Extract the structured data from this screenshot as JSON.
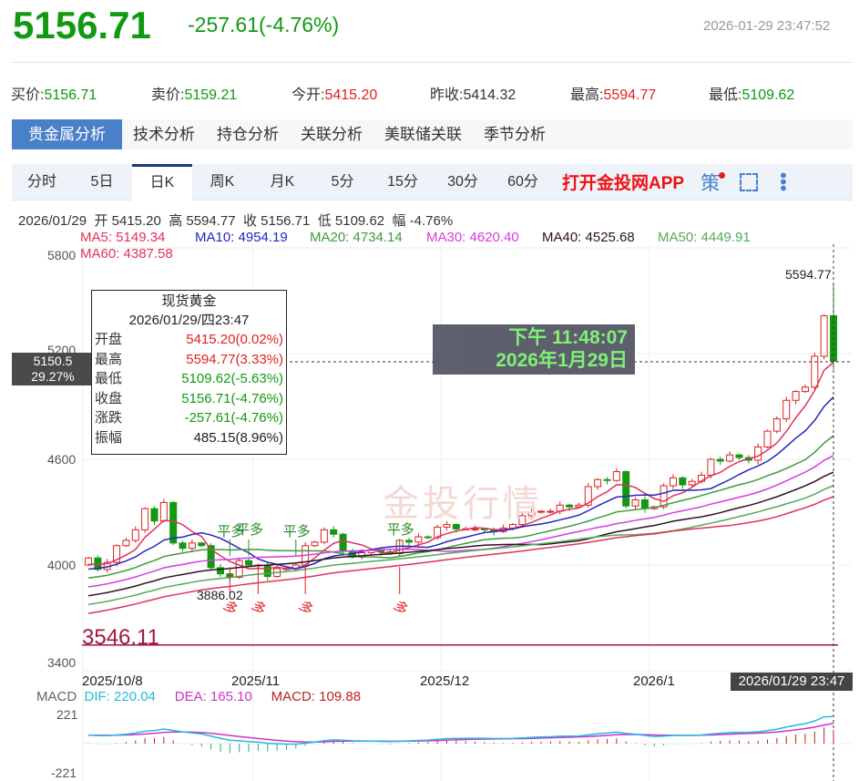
{
  "header": {
    "price": "5156.71",
    "change": "-257.61(-4.76%)",
    "timestamp": "2026-01-29 23:47:52"
  },
  "quotes": [
    {
      "label": "买价:",
      "value": "5156.71",
      "dir": "dn"
    },
    {
      "label": "卖价:",
      "value": "5159.21",
      "dir": "dn"
    },
    {
      "label": "今开:",
      "value": "5415.20",
      "dir": "up"
    },
    {
      "label": "昨收:",
      "value": "5414.32",
      "dir": "ne"
    },
    {
      "label": "最高:",
      "value": "5594.77",
      "dir": "up"
    },
    {
      "label": "最低:",
      "value": "5109.62",
      "dir": "dn"
    }
  ],
  "tabs": [
    "贵金属分析",
    "技术分析",
    "持仓分析",
    "关联分析",
    "美联储关联",
    "季节分析"
  ],
  "periods": [
    "分时",
    "5日",
    "日K",
    "周K",
    "月K",
    "5分",
    "15分",
    "30分",
    "60分"
  ],
  "app_link": "打开金投网APP",
  "strategy_label": "策",
  "info_line": {
    "date": "2026/01/29",
    "open_l": "开",
    "open": "5415.20",
    "high_l": "高",
    "high": "5594.77",
    "close_l": "收",
    "close": "5156.71",
    "low_l": "低",
    "low": "5109.62",
    "amp_l": "幅",
    "amp": "-4.76%"
  },
  "ma": [
    {
      "label": "MA5: 5149.34",
      "color": "#e0325a"
    },
    {
      "label": "MA10: 4954.19",
      "color": "#2626c0"
    },
    {
      "label": "MA20: 4734.14",
      "color": "#3f9a3f"
    },
    {
      "label": "MA30: 4620.40",
      "color": "#d43ce0"
    },
    {
      "label": "MA40: 4525.68",
      "color": "#2a1420"
    },
    {
      "label": "MA50: 4449.91",
      "color": "#55a955"
    },
    {
      "label": "MA60: 4387.58",
      "color": "#e0325a"
    }
  ],
  "tooltip": {
    "title": "现货黄金",
    "datetime": "2026/01/29/四23:47",
    "rows": [
      {
        "label": "开盘",
        "value": "5415.20(0.02%)",
        "color": "#e02020"
      },
      {
        "label": "最高",
        "value": "5594.77(3.33%)",
        "color": "#e02020"
      },
      {
        "label": "最低",
        "value": "5109.62(-5.63%)",
        "color": "#119911"
      },
      {
        "label": "收盘",
        "value": "5156.71(-4.76%)",
        "color": "#119911"
      },
      {
        "label": "涨跌",
        "value": "-257.61(-4.76%)",
        "color": "#119911"
      },
      {
        "label": "振幅",
        "value": "485.15(8.96%)",
        "color": "#222"
      }
    ]
  },
  "crosshair": {
    "price": "5150.5",
    "pct": "29.27%",
    "date": "2026/01/29 23:47"
  },
  "clock": {
    "time": "下午 11:48:07",
    "date": "2026年1月29日"
  },
  "watermark": "金投行情",
  "chart_data": {
    "type": "candlestick",
    "y_ticks": [
      "5800",
      "5200",
      "4600",
      "4000",
      "3400"
    ],
    "ylim": [
      3400,
      5800
    ],
    "x_ticks": [
      {
        "label": "2025/10/8",
        "index": 0
      },
      {
        "label": "2025/11",
        "index": 18
      },
      {
        "label": "2025/12",
        "index": 38
      },
      {
        "label": "2026/1",
        "index": 60
      }
    ],
    "closes": [
      4040,
      3975,
      4015,
      4110,
      4140,
      4200,
      4320,
      4250,
      4355,
      4125,
      4095,
      4125,
      4110,
      3985,
      3950,
      3930,
      4025,
      4000,
      4000,
      3935,
      3980,
      3980,
      4000,
      4110,
      4130,
      4200,
      4175,
      4080,
      4045,
      4070,
      4085,
      4075,
      4065,
      4140,
      4130,
      4160,
      4155,
      4215,
      4230,
      4205,
      4205,
      4205,
      4200,
      4190,
      4210,
      4230,
      4280,
      4300,
      4305,
      4305,
      4340,
      4330,
      4340,
      4445,
      4485,
      4480,
      4530,
      4335,
      4370,
      4320,
      4330,
      4450,
      4495,
      4455,
      4475,
      4510,
      4600,
      4590,
      4625,
      4610,
      4595,
      4670,
      4760,
      4830,
      4935,
      4985,
      5010,
      5185,
      5415
    ],
    "last_ohlc": [
      5415.2,
      5594.77,
      5109.62,
      5156.71
    ],
    "max_label": "5594.77",
    "min_label": "3886.02",
    "min_index": 15,
    "support_line": {
      "value": 3546.11,
      "label": "3546.11"
    },
    "annotations": [
      {
        "text": "平多",
        "index": 15,
        "type": "close"
      },
      {
        "text": "平多",
        "index": 17,
        "type": "close"
      },
      {
        "text": "平多",
        "index": 22,
        "type": "close"
      },
      {
        "text": "平多",
        "index": 33,
        "type": "close"
      },
      {
        "text": "多",
        "index": 15,
        "type": "long"
      },
      {
        "text": "多",
        "index": 18,
        "type": "long"
      },
      {
        "text": "多",
        "index": 23,
        "type": "long"
      },
      {
        "text": "多",
        "index": 33,
        "type": "long"
      }
    ],
    "macd": {
      "label": "MACD",
      "dif": "DIF: 220.04",
      "dea": "DEA: 165.10",
      "macd": "MACD: 109.88",
      "ticks": [
        "221",
        "-221"
      ],
      "dif_color": "#22bbdd",
      "dea_color": "#cc33cc",
      "macd_color": "#bb2222"
    }
  }
}
